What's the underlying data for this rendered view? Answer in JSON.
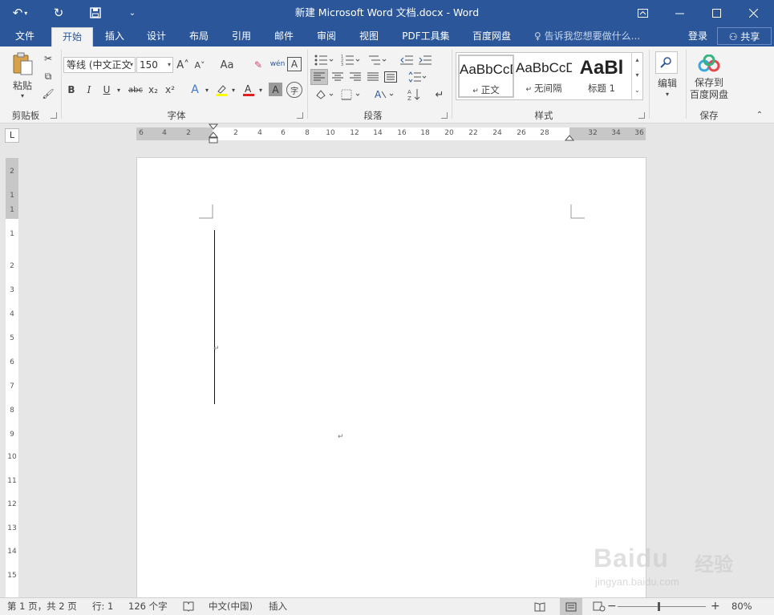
{
  "window": {
    "title": "新建 Microsoft Word 文档.docx - Word",
    "undo_icon": "undo-icon",
    "redo_icon": "repeat-icon",
    "save_icon": "save-icon",
    "customize_icon": "customize-icon",
    "ribbon_options_icon": "ribbon-display-options-icon",
    "minimize_icon": "minimize-icon",
    "maximize_icon": "maximize-icon",
    "close_icon": "close-icon"
  },
  "tabs": [
    {
      "label": "文件"
    },
    {
      "label": "开始"
    },
    {
      "label": "插入"
    },
    {
      "label": "设计"
    },
    {
      "label": "布局"
    },
    {
      "label": "引用"
    },
    {
      "label": "邮件"
    },
    {
      "label": "审阅"
    },
    {
      "label": "视图"
    },
    {
      "label": "PDF工具集"
    },
    {
      "label": "百度网盘"
    }
  ],
  "active_tab": "开始",
  "tell_me": "告诉我您想要做什么...",
  "login": "登录",
  "share": "共享",
  "ribbon": {
    "clipboard": {
      "paste": "粘贴",
      "label": "剪贴板"
    },
    "font": {
      "font_name": "等线 (中文正文",
      "font_size": "150",
      "label": "字体",
      "bold": "B",
      "italic": "I",
      "underline": "U",
      "strike": "abc",
      "subscript": "x₂",
      "superscript": "x²",
      "grow": "A˄",
      "shrink": "A˅",
      "case": "Aa",
      "phonetic": "wén",
      "border_char": "A",
      "effects": "A",
      "char_shade": "A",
      "enclose": "字"
    },
    "paragraph": {
      "label": "段落"
    },
    "styles": {
      "label": "样式",
      "items": [
        {
          "sample": "AaBbCcD",
          "name": "正文"
        },
        {
          "sample": "AaBbCcD",
          "name": "无间隔"
        },
        {
          "sample": "AaBl",
          "name": "标题 1"
        }
      ]
    },
    "editing": {
      "label": "编辑"
    },
    "save": {
      "button": "保存到\n百度网盘",
      "line1": "保存到",
      "line2": "百度网盘",
      "label": "保存"
    }
  },
  "ruler": {
    "corner": "L",
    "h_numbers": [
      "6",
      "4",
      "2",
      "2",
      "4",
      "6",
      "8",
      "10",
      "12",
      "14",
      "16",
      "18",
      "20",
      "22",
      "24",
      "26",
      "28",
      "32",
      "34",
      "36"
    ],
    "v_numbers": [
      "2",
      "1",
      "1",
      "1",
      "2",
      "3",
      "4",
      "5",
      "6",
      "7",
      "8",
      "9",
      "10",
      "11",
      "12",
      "13",
      "14",
      "15"
    ]
  },
  "status": {
    "page": "第 1 页，共 2 页",
    "line": "行: 1",
    "words": "126 个字",
    "language": "中文(中国)",
    "mode": "插入",
    "zoom": "80%",
    "zoom_minus": "−",
    "zoom_plus": "+"
  },
  "watermark": {
    "brand": "Baidu",
    "cn": "经验",
    "url": "jingyan.baidu.com"
  }
}
